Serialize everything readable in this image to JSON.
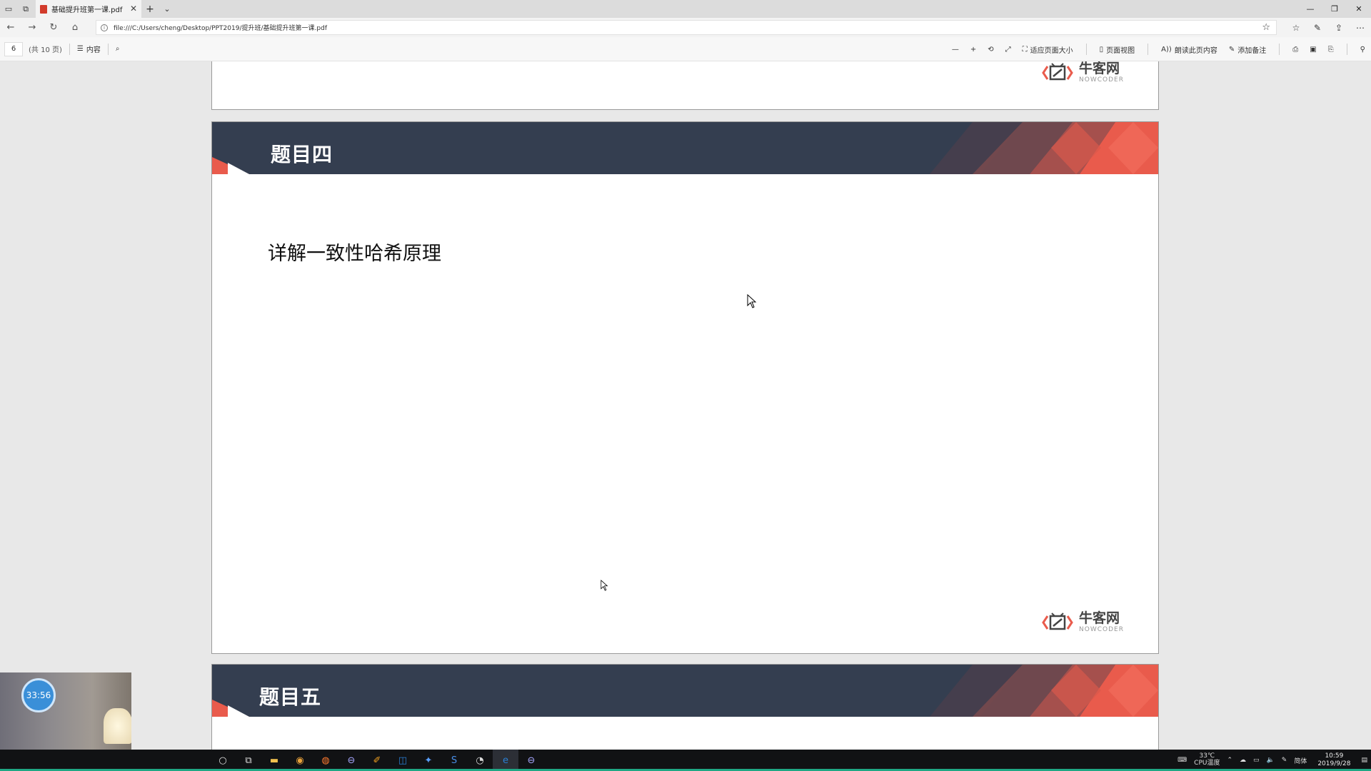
{
  "browser": {
    "tab_title": "基础提升班第一课.pdf",
    "address": "file:///C:/Users/cheng/Desktop/PPT2019/提升班/基础提升班第一课.pdf"
  },
  "pdf_toolbar": {
    "current_page": "6",
    "total_pages": "(共 10 页)",
    "contents_label": "内容",
    "fit_page_label": "适应页面大小",
    "page_view_label": "页面视图",
    "read_aloud_label": "朗读此页内容",
    "add_note_label": "添加备注"
  },
  "slides": {
    "main_title": "题目四",
    "main_body": "详解一致性哈希原理",
    "next_title": "题目五",
    "logo_cn": "牛客网",
    "logo_en": "NOWCODER"
  },
  "webcam": {
    "timer": "33:56"
  },
  "taskbar": {
    "temperature": "33℃",
    "cpu_label": "CPU温度",
    "ime": "简体",
    "time": "10:59",
    "date": "2019/9/28"
  },
  "colors": {
    "slide_header": "#343e50",
    "slide_accent": "#e95b4c",
    "timer": "#3a8fd8"
  }
}
